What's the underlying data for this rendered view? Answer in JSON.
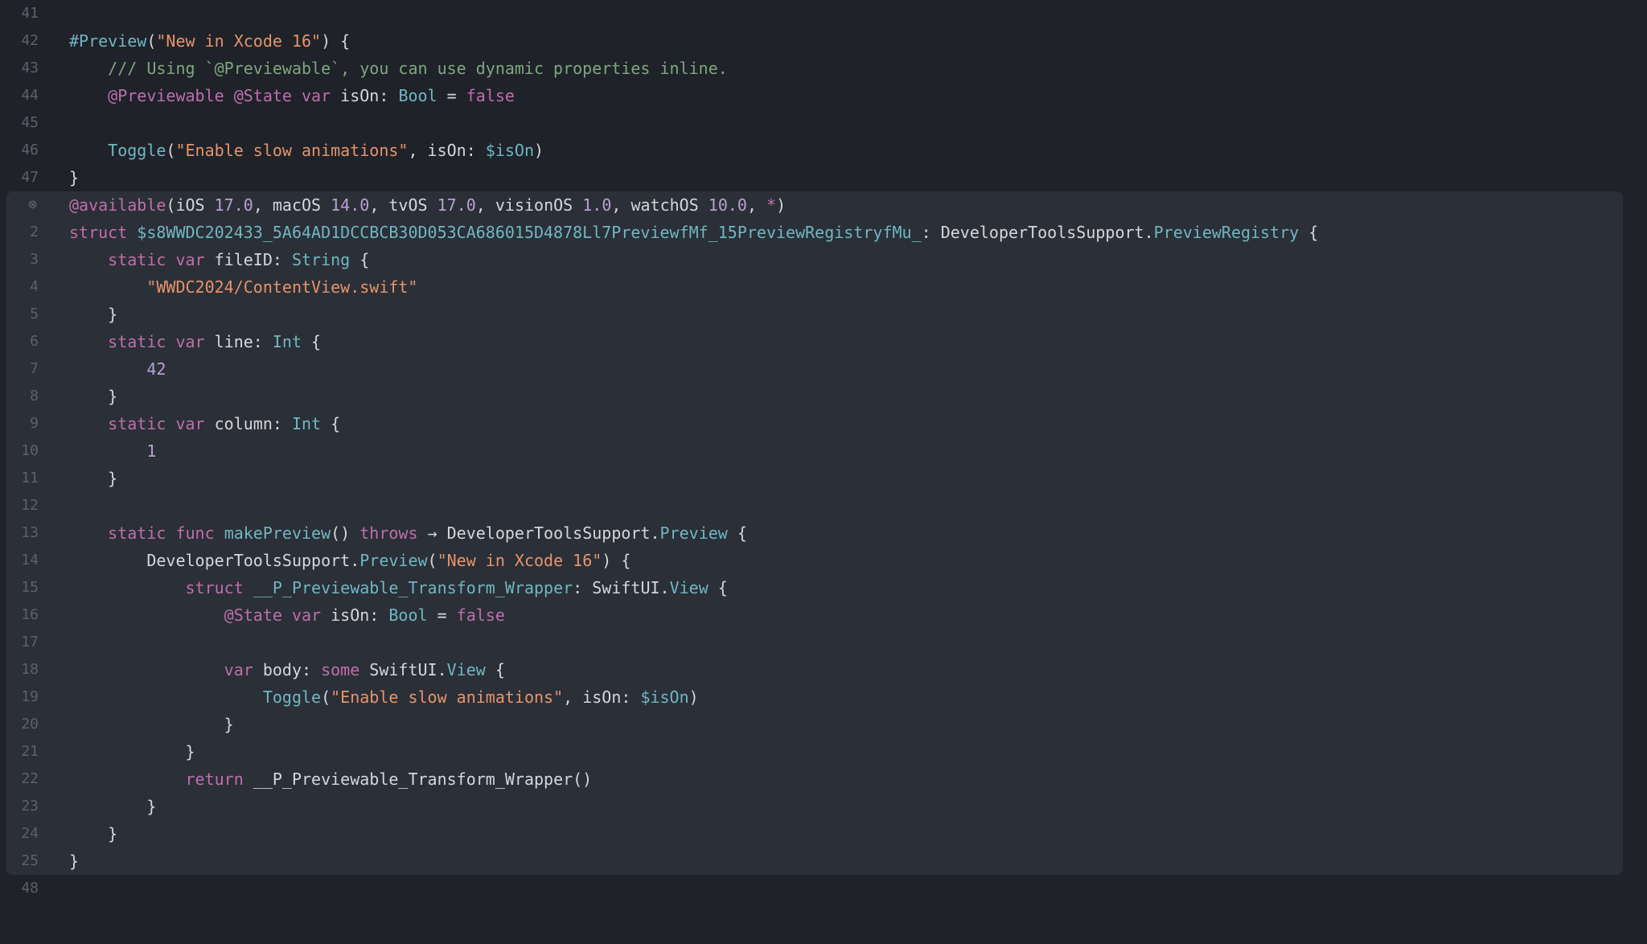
{
  "top": {
    "lines": [
      {
        "n": "41",
        "tokens": []
      },
      {
        "n": "42",
        "tokens": [
          {
            "c": "t-macro",
            "t": "#Preview"
          },
          {
            "c": "t-plain",
            "t": "("
          },
          {
            "c": "t-string",
            "t": "\"New in Xcode 16\""
          },
          {
            "c": "t-plain",
            "t": ") {"
          }
        ]
      },
      {
        "n": "43",
        "tokens": [
          {
            "c": "t-plain",
            "t": "    "
          },
          {
            "c": "t-comment",
            "t": "/// Using `@Previewable`, you can use dynamic properties inline."
          }
        ]
      },
      {
        "n": "44",
        "tokens": [
          {
            "c": "t-plain",
            "t": "    "
          },
          {
            "c": "t-key",
            "t": "@Previewable"
          },
          {
            "c": "t-plain",
            "t": " "
          },
          {
            "c": "t-key",
            "t": "@State"
          },
          {
            "c": "t-plain",
            "t": " "
          },
          {
            "c": "t-key",
            "t": "var"
          },
          {
            "c": "t-plain",
            "t": " isOn: "
          },
          {
            "c": "t-type",
            "t": "Bool"
          },
          {
            "c": "t-plain",
            "t": " = "
          },
          {
            "c": "t-bool",
            "t": "false"
          }
        ]
      },
      {
        "n": "45",
        "tokens": []
      },
      {
        "n": "46",
        "tokens": [
          {
            "c": "t-plain",
            "t": "    "
          },
          {
            "c": "t-type",
            "t": "Toggle"
          },
          {
            "c": "t-plain",
            "t": "("
          },
          {
            "c": "t-string",
            "t": "\"Enable slow animations\""
          },
          {
            "c": "t-plain",
            "t": ", isOn: "
          },
          {
            "c": "t-type",
            "t": "$isOn"
          },
          {
            "c": "t-plain",
            "t": ")"
          }
        ]
      },
      {
        "n": "47",
        "tokens": [
          {
            "c": "t-plain",
            "t": "}"
          }
        ]
      }
    ]
  },
  "expansion": {
    "lines": [
      {
        "n": "⊗",
        "icon": true,
        "tokens": [
          {
            "c": "t-key",
            "t": "@available"
          },
          {
            "c": "t-plain",
            "t": "(iOS "
          },
          {
            "c": "t-num",
            "t": "17.0"
          },
          {
            "c": "t-plain",
            "t": ", macOS "
          },
          {
            "c": "t-num",
            "t": "14.0"
          },
          {
            "c": "t-plain",
            "t": ", tvOS "
          },
          {
            "c": "t-num",
            "t": "17.0"
          },
          {
            "c": "t-plain",
            "t": ", visionOS "
          },
          {
            "c": "t-num",
            "t": "1.0"
          },
          {
            "c": "t-plain",
            "t": ", watchOS "
          },
          {
            "c": "t-num",
            "t": "10.0"
          },
          {
            "c": "t-plain",
            "t": ", "
          },
          {
            "c": "t-key",
            "t": "*"
          },
          {
            "c": "t-plain",
            "t": ")"
          }
        ]
      },
      {
        "n": "2",
        "tokens": [
          {
            "c": "t-key",
            "t": "struct"
          },
          {
            "c": "t-plain",
            "t": " "
          },
          {
            "c": "t-type",
            "t": "$s8WWDC202433_5A64AD1DCCBCB30D053CA686015D4878Ll7PreviewfMf_15PreviewRegistryfMu_"
          },
          {
            "c": "t-plain",
            "t": ": DeveloperToolsSupport."
          },
          {
            "c": "t-type",
            "t": "PreviewRegistry"
          },
          {
            "c": "t-plain",
            "t": " {"
          }
        ]
      },
      {
        "n": "3",
        "tokens": [
          {
            "c": "t-plain",
            "t": "    "
          },
          {
            "c": "t-key",
            "t": "static"
          },
          {
            "c": "t-plain",
            "t": " "
          },
          {
            "c": "t-key",
            "t": "var"
          },
          {
            "c": "t-plain",
            "t": " fileID: "
          },
          {
            "c": "t-type",
            "t": "String"
          },
          {
            "c": "t-plain",
            "t": " {"
          }
        ]
      },
      {
        "n": "4",
        "tokens": [
          {
            "c": "t-plain",
            "t": "        "
          },
          {
            "c": "t-string",
            "t": "\"WWDC2024/ContentView.swift\""
          }
        ]
      },
      {
        "n": "5",
        "tokens": [
          {
            "c": "t-plain",
            "t": "    }"
          }
        ]
      },
      {
        "n": "6",
        "tokens": [
          {
            "c": "t-plain",
            "t": "    "
          },
          {
            "c": "t-key",
            "t": "static"
          },
          {
            "c": "t-plain",
            "t": " "
          },
          {
            "c": "t-key",
            "t": "var"
          },
          {
            "c": "t-plain",
            "t": " line: "
          },
          {
            "c": "t-type",
            "t": "Int"
          },
          {
            "c": "t-plain",
            "t": " {"
          }
        ]
      },
      {
        "n": "7",
        "tokens": [
          {
            "c": "t-plain",
            "t": "        "
          },
          {
            "c": "t-num",
            "t": "42"
          }
        ]
      },
      {
        "n": "8",
        "tokens": [
          {
            "c": "t-plain",
            "t": "    }"
          }
        ]
      },
      {
        "n": "9",
        "tokens": [
          {
            "c": "t-plain",
            "t": "    "
          },
          {
            "c": "t-key",
            "t": "static"
          },
          {
            "c": "t-plain",
            "t": " "
          },
          {
            "c": "t-key",
            "t": "var"
          },
          {
            "c": "t-plain",
            "t": " column: "
          },
          {
            "c": "t-type",
            "t": "Int"
          },
          {
            "c": "t-plain",
            "t": " {"
          }
        ]
      },
      {
        "n": "10",
        "tokens": [
          {
            "c": "t-plain",
            "t": "        "
          },
          {
            "c": "t-num",
            "t": "1"
          }
        ]
      },
      {
        "n": "11",
        "tokens": [
          {
            "c": "t-plain",
            "t": "    }"
          }
        ]
      },
      {
        "n": "12",
        "tokens": []
      },
      {
        "n": "13",
        "tokens": [
          {
            "c": "t-plain",
            "t": "    "
          },
          {
            "c": "t-key",
            "t": "static"
          },
          {
            "c": "t-plain",
            "t": " "
          },
          {
            "c": "t-key",
            "t": "func"
          },
          {
            "c": "t-plain",
            "t": " "
          },
          {
            "c": "t-funcname",
            "t": "makePreview"
          },
          {
            "c": "t-plain",
            "t": "() "
          },
          {
            "c": "t-key",
            "t": "throws"
          },
          {
            "c": "t-plain",
            "t": " → DeveloperToolsSupport."
          },
          {
            "c": "t-type",
            "t": "Preview"
          },
          {
            "c": "t-plain",
            "t": " {"
          }
        ]
      },
      {
        "n": "14",
        "tokens": [
          {
            "c": "t-plain",
            "t": "        DeveloperToolsSupport."
          },
          {
            "c": "t-type",
            "t": "Preview"
          },
          {
            "c": "t-plain",
            "t": "("
          },
          {
            "c": "t-string",
            "t": "\"New in Xcode 16\""
          },
          {
            "c": "t-plain",
            "t": ") {"
          }
        ]
      },
      {
        "n": "15",
        "tokens": [
          {
            "c": "t-plain",
            "t": "            "
          },
          {
            "c": "t-key",
            "t": "struct"
          },
          {
            "c": "t-plain",
            "t": " "
          },
          {
            "c": "t-type",
            "t": "__P_Previewable_Transform_Wrapper"
          },
          {
            "c": "t-plain",
            "t": ": SwiftUI."
          },
          {
            "c": "t-type",
            "t": "View"
          },
          {
            "c": "t-plain",
            "t": " {"
          }
        ]
      },
      {
        "n": "16",
        "tokens": [
          {
            "c": "t-plain",
            "t": "                "
          },
          {
            "c": "t-key",
            "t": "@State"
          },
          {
            "c": "t-plain",
            "t": " "
          },
          {
            "c": "t-key",
            "t": "var"
          },
          {
            "c": "t-plain",
            "t": " isOn: "
          },
          {
            "c": "t-type",
            "t": "Bool"
          },
          {
            "c": "t-plain",
            "t": " = "
          },
          {
            "c": "t-bool",
            "t": "false"
          }
        ]
      },
      {
        "n": "17",
        "tokens": []
      },
      {
        "n": "18",
        "tokens": [
          {
            "c": "t-plain",
            "t": "                "
          },
          {
            "c": "t-key",
            "t": "var"
          },
          {
            "c": "t-plain",
            "t": " body: "
          },
          {
            "c": "t-key",
            "t": "some"
          },
          {
            "c": "t-plain",
            "t": " SwiftUI."
          },
          {
            "c": "t-type",
            "t": "View"
          },
          {
            "c": "t-plain",
            "t": " {"
          }
        ]
      },
      {
        "n": "19",
        "tokens": [
          {
            "c": "t-plain",
            "t": "                    "
          },
          {
            "c": "t-type",
            "t": "Toggle"
          },
          {
            "c": "t-plain",
            "t": "("
          },
          {
            "c": "t-string",
            "t": "\"Enable slow animations\""
          },
          {
            "c": "t-plain",
            "t": ", isOn: "
          },
          {
            "c": "t-type",
            "t": "$isOn"
          },
          {
            "c": "t-plain",
            "t": ")"
          }
        ]
      },
      {
        "n": "20",
        "tokens": [
          {
            "c": "t-plain",
            "t": "                }"
          }
        ]
      },
      {
        "n": "21",
        "tokens": [
          {
            "c": "t-plain",
            "t": "            }"
          }
        ]
      },
      {
        "n": "22",
        "tokens": [
          {
            "c": "t-plain",
            "t": "            "
          },
          {
            "c": "t-key",
            "t": "return"
          },
          {
            "c": "t-plain",
            "t": " __P_Previewable_Transform_Wrapper()"
          }
        ]
      },
      {
        "n": "23",
        "tokens": [
          {
            "c": "t-plain",
            "t": "        }"
          }
        ]
      },
      {
        "n": "24",
        "tokens": [
          {
            "c": "t-plain",
            "t": "    }"
          }
        ]
      },
      {
        "n": "25",
        "tokens": [
          {
            "c": "t-plain",
            "t": "}"
          }
        ]
      }
    ]
  },
  "bottom": {
    "lines": [
      {
        "n": "48",
        "tokens": []
      }
    ]
  }
}
